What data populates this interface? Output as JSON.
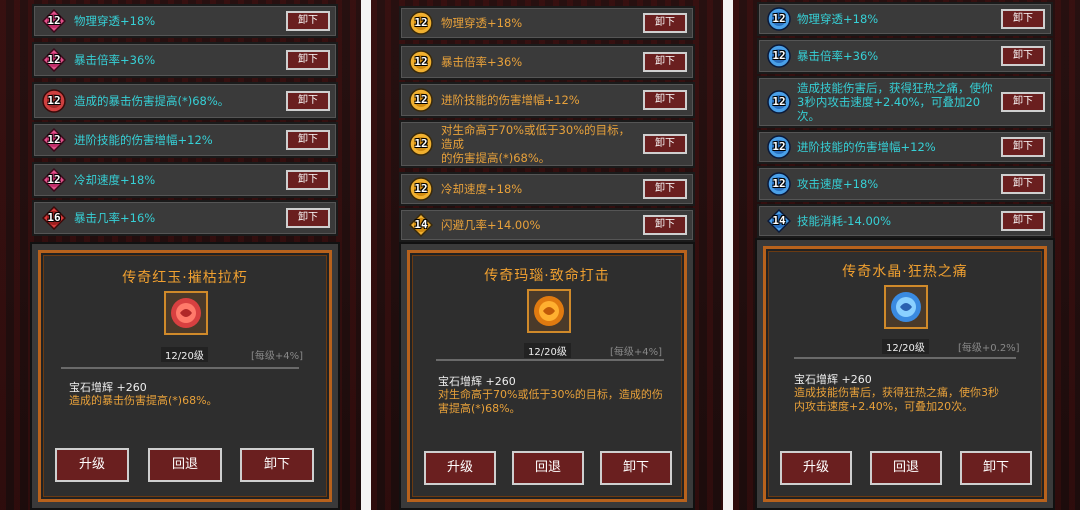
{
  "remove_label": "卸下",
  "colors": {
    "cyan_text": "#36d0d6",
    "orange_text": "#e8a13a",
    "title": "#f0a030",
    "accent_border": "#b8621c"
  },
  "panels": [
    {
      "gems": [
        {
          "level": "12",
          "text": "物理穿透+18%",
          "badge": "pink-diamond-icon"
        },
        {
          "level": "12",
          "text": "暴击倍率+36%",
          "badge": "pink-diamond-icon"
        },
        {
          "level": "12",
          "text": "造成的暴击伤害提高(*)68%。",
          "badge": "red-circle-icon",
          "orange": false
        },
        {
          "level": "12",
          "text": "进阶技能的伤害增幅+12%",
          "badge": "pink-diamond-icon"
        },
        {
          "level": "12",
          "text": "冷却速度+18%",
          "badge": "pink-diamond-icon"
        },
        {
          "level": "16",
          "text": "暴击几率+16%",
          "badge": "red-diamond-icon"
        }
      ],
      "title": "传奇红玉·摧枯拉朽",
      "gem_icon": "red-gem-icon",
      "level_text": "12/20级",
      "per_level": "[每级+4%]",
      "stat": "宝石增辉 +260",
      "desc_lines": [
        "造成的暴击伤害提高(*)68%。"
      ],
      "buttons": {
        "upgrade": "升级",
        "revert": "回退",
        "unequip": "卸下"
      }
    },
    {
      "gems": [
        {
          "level": "12",
          "text": "物理穿透+18%",
          "badge": "gold-circle-icon"
        },
        {
          "level": "12",
          "text": "暴击倍率+36%",
          "badge": "gold-circle-icon"
        },
        {
          "level": "12",
          "text": "进阶技能的伤害增幅+12%",
          "badge": "gold-circle-icon"
        },
        {
          "level": "12",
          "text_lines": [
            "对生命高于70%或低于30%的目标，造成",
            "的伤害提高(*)68%。"
          ],
          "badge": "gold-circle-icon"
        },
        {
          "level": "12",
          "text": "冷却速度+18%",
          "badge": "gold-circle-icon"
        },
        {
          "level": "14",
          "text": "闪避几率+14.00%",
          "badge": "gold-diamond-icon"
        }
      ],
      "title": "传奇玛瑙·致命打击",
      "gem_icon": "orange-gem-icon",
      "level_text": "12/20级",
      "per_level": "[每级+4%]",
      "stat": "宝石增辉 +260",
      "desc_lines": [
        "对生命高于70%或低于30%的目标，造成的伤",
        "害提高(*)68%。"
      ],
      "buttons": {
        "upgrade": "升级",
        "revert": "回退",
        "unequip": "卸下"
      }
    },
    {
      "gems": [
        {
          "level": "12",
          "text": "物理穿透+18%",
          "badge": "blue-circle-icon"
        },
        {
          "level": "12",
          "text": "暴击倍率+36%",
          "badge": "blue-circle-icon"
        },
        {
          "level": "12",
          "text_lines": [
            "造成技能伤害后，获得狂热之痛，使你",
            "3秒内攻击速度+2.40%，可叠加20次。"
          ],
          "badge": "blue-circle-icon"
        },
        {
          "level": "12",
          "text": "进阶技能的伤害增幅+12%",
          "badge": "blue-circle-icon"
        },
        {
          "level": "12",
          "text": "攻击速度+18%",
          "badge": "blue-circle-icon"
        },
        {
          "level": "14",
          "text": "技能消耗-14.00%",
          "badge": "blue-diamond-icon"
        }
      ],
      "title": "传奇水晶·狂热之痛",
      "gem_icon": "blue-gem-icon",
      "level_text": "12/20级",
      "per_level": "[每级+0.2%]",
      "stat": "宝石增辉 +260",
      "desc_lines": [
        "造成技能伤害后，获得狂热之痛，使你3秒",
        "内攻击速度+2.40%，可叠加20次。"
      ],
      "buttons": {
        "upgrade": "升级",
        "revert": "回退",
        "unequip": "卸下"
      }
    }
  ]
}
